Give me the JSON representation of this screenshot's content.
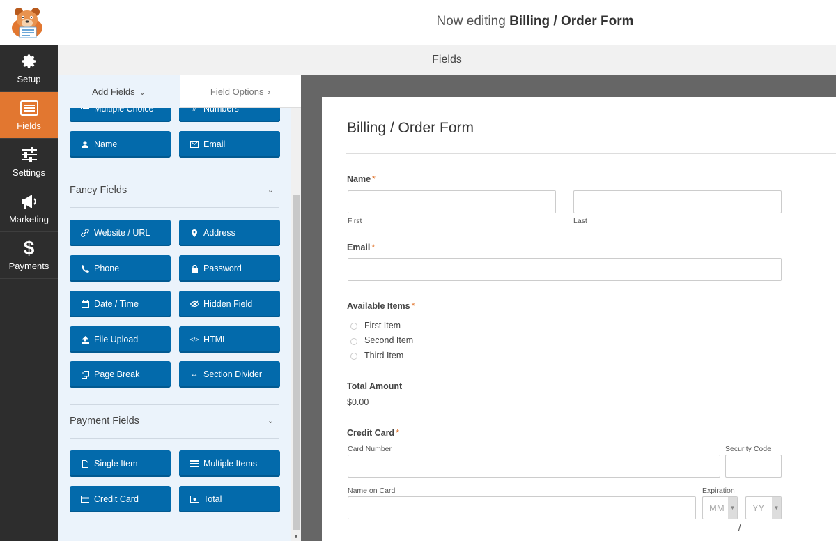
{
  "header": {
    "editing_prefix": "Now editing",
    "form_name": "Billing / Order Form"
  },
  "nav": [
    {
      "label": "Setup",
      "icon": "gear-icon",
      "active": false
    },
    {
      "label": "Fields",
      "icon": "list-icon",
      "active": true
    },
    {
      "label": "Settings",
      "icon": "sliders-icon",
      "active": false
    },
    {
      "label": "Marketing",
      "icon": "megaphone-icon",
      "active": false
    },
    {
      "label": "Payments",
      "icon": "dollar-icon",
      "active": false
    }
  ],
  "fields_bar": {
    "title": "Fields"
  },
  "panel": {
    "tabs": {
      "add": "Add Fields",
      "options": "Field Options"
    },
    "partial_buttons": [
      "Multiple Choice",
      "Numbers"
    ],
    "standard_buttons": [
      "Name",
      "Email"
    ],
    "fancy": {
      "title": "Fancy Fields",
      "buttons": [
        "Website / URL",
        "Address",
        "Phone",
        "Password",
        "Date / Time",
        "Hidden Field",
        "File Upload",
        "HTML",
        "Page Break",
        "Section Divider"
      ]
    },
    "payment": {
      "title": "Payment Fields",
      "buttons": [
        "Single Item",
        "Multiple Items",
        "Credit Card",
        "Total"
      ]
    }
  },
  "form": {
    "title": "Billing / Order Form",
    "name": {
      "label": "Name",
      "required": "*",
      "first": "First",
      "last": "Last"
    },
    "email": {
      "label": "Email",
      "required": "*"
    },
    "items": {
      "label": "Available Items",
      "required": "*",
      "options": [
        "First Item",
        "Second Item",
        "Third Item"
      ]
    },
    "total": {
      "label": "Total Amount",
      "value": "$0.00"
    },
    "card": {
      "label": "Credit Card",
      "required": "*",
      "number": "Card Number",
      "security": "Security Code",
      "name_on_card": "Name on Card",
      "expiration": "Expiration",
      "month_placeholder": "MM",
      "year_placeholder": "YY",
      "separator": "/"
    }
  },
  "colors": {
    "accent": "#e27730",
    "button": "#036aab",
    "nav_bg": "#2d2d2d",
    "panel_bg": "#ebf3fb"
  }
}
